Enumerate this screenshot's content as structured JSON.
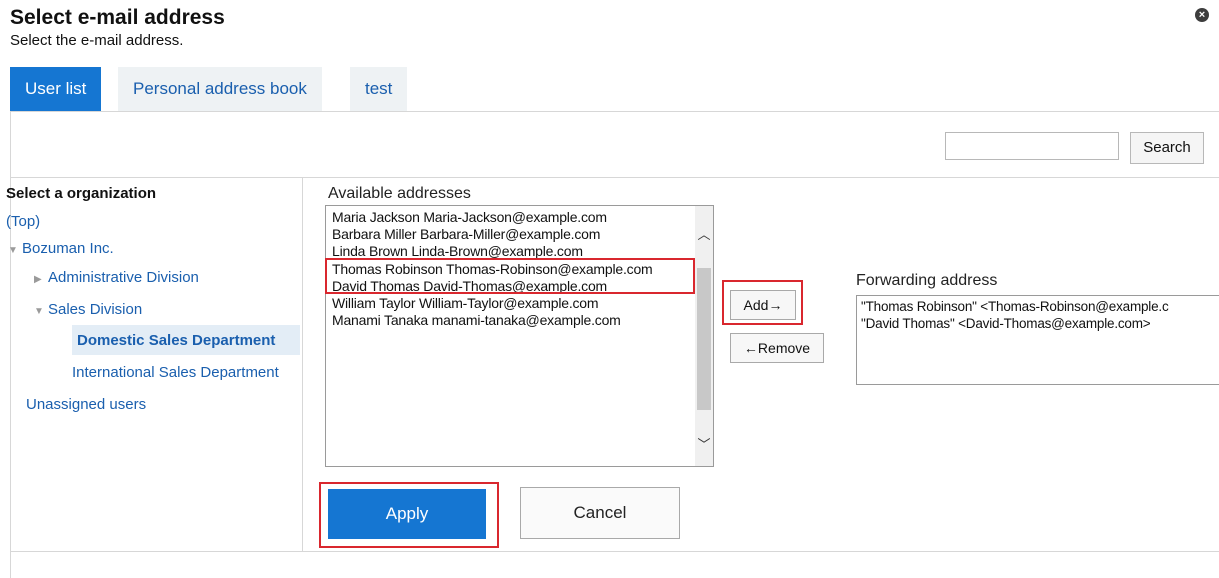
{
  "dialog": {
    "title": "Select e-mail address",
    "subtitle": "Select the e-mail address.",
    "close_icon": "close-circle-icon"
  },
  "tabs": [
    {
      "label": "User list",
      "active": true
    },
    {
      "label": "Personal address book",
      "active": false
    },
    {
      "label": "test",
      "active": false
    }
  ],
  "search": {
    "value": "",
    "button_label": "Search"
  },
  "organization": {
    "heading": "Select a organization",
    "top_label": "(Top)",
    "company": "Bozuman Inc.",
    "divisions": [
      {
        "label": "Administrative Division",
        "expanded": false
      },
      {
        "label": "Sales Division",
        "expanded": true
      }
    ],
    "departments": [
      "Domestic Sales Department",
      "International Sales Department"
    ],
    "selected_department": "Domestic Sales Department",
    "unassigned": "Unassigned users"
  },
  "available": {
    "label": "Available addresses",
    "items": [
      "Maria Jackson Maria-Jackson@example.com",
      "Barbara Miller Barbara-Miller@example.com",
      "Linda Brown Linda-Brown@example.com",
      "Thomas Robinson Thomas-Robinson@example.com",
      "David Thomas David-Thomas@example.com",
      "William Taylor William-Taylor@example.com",
      "Manami Tanaka manami-tanaka@example.com"
    ],
    "selected_items": [
      "Thomas Robinson Thomas-Robinson@example.com",
      "David Thomas David-Thomas@example.com"
    ]
  },
  "actions": {
    "add_label": "Add→",
    "remove_label": "←Remove"
  },
  "forwarding": {
    "label": "Forwarding address",
    "items": [
      "\"Thomas Robinson\" <Thomas-Robinson@example.c",
      "\"David Thomas\" <David-Thomas@example.com>"
    ]
  },
  "footer": {
    "apply_label": "Apply",
    "cancel_label": "Cancel"
  },
  "colors": {
    "accent": "#1576d2",
    "highlight_border": "#d9272e",
    "link": "#1a5fae"
  }
}
